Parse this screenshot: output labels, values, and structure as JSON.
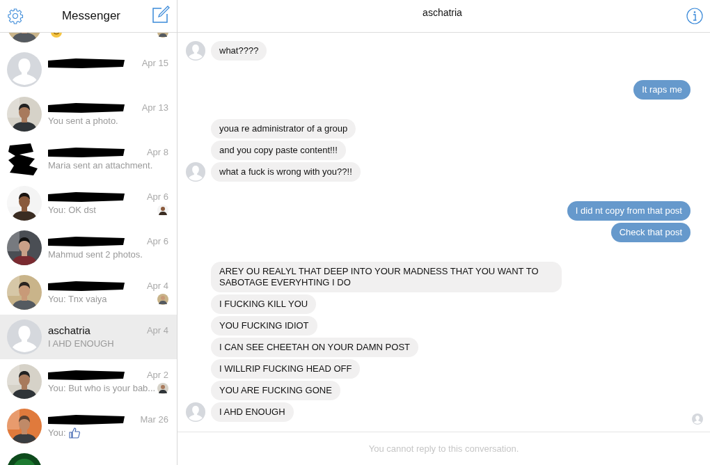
{
  "sidebar": {
    "title": "Messenger",
    "conversations": [
      {
        "preview_icon": {
          "kind": "smiley"
        },
        "seen_avatar": true,
        "selected": false
      },
      {
        "avatar": {
          "kind": "default"
        },
        "redacted": true,
        "date": "Apr 15",
        "selected": false
      },
      {
        "redacted": true,
        "date": "Apr 13",
        "preview": "You sent a photo.",
        "selected": false
      },
      {
        "avatar": {
          "kind": "redacted"
        },
        "redacted": true,
        "date": "Apr 8",
        "preview": "Maria sent an attachment.",
        "selected": false
      },
      {
        "redacted": true,
        "date": "Apr 6",
        "preview": "You: OK dst",
        "seen_avatar": true,
        "selected": false
      },
      {
        "redacted": true,
        "date": "Apr 6",
        "preview": "Mahmud sent 2 photos.",
        "selected": false
      },
      {
        "redacted": true,
        "date": "Apr 4",
        "preview": "You: Tnx vaiya",
        "seen_avatar": true,
        "selected": false
      },
      {
        "avatar": {
          "kind": "default"
        },
        "name": "aschatria",
        "date": "Apr 4",
        "preview": "I AHD ENOUGH",
        "selected": true
      },
      {
        "redacted": true,
        "date": "Apr 2",
        "preview": "You: But who is your bab...",
        "seen_avatar": true,
        "selected": false
      },
      {
        "redacted": true,
        "date": "Mar 26",
        "preview": "You:",
        "preview_icon": {
          "kind": "like"
        },
        "selected": false
      },
      {
        "avatar": {
          "kind": "logo"
        },
        "selected": false
      }
    ]
  },
  "chat": {
    "title": "aschatria",
    "seen": true,
    "groups": [
      {
        "kind": "incoming",
        "messages": [
          "what????"
        ]
      },
      {
        "kind": "outgoing",
        "messages": [
          "It raps me"
        ]
      },
      {
        "kind": "incoming",
        "messages": [
          "youa re administrator of a group",
          "and you copy paste content!!!",
          "what a fuck is wrong with you??!!"
        ]
      },
      {
        "kind": "outgoing",
        "messages": [
          "I did nt copy from that post",
          "Check that post"
        ]
      },
      {
        "kind": "incoming",
        "messages": [
          "AREY OU REALYL THAT DEEP INTO YOUR MADNESS THAT YOU WANT TO SABOTAGE EVERYHTING I DO",
          "I FUCKING KILL YOU",
          "YOU FUCKING IDIOT",
          "I CAN SEE CHEETAH ON YOUR DAMN POST",
          "I WILLRIP FUCKING HEAD OFF",
          "YOU ARE FUCKING GONE",
          "I AHD ENOUGH"
        ]
      }
    ],
    "footer": "You cannot reply to this conversation."
  }
}
